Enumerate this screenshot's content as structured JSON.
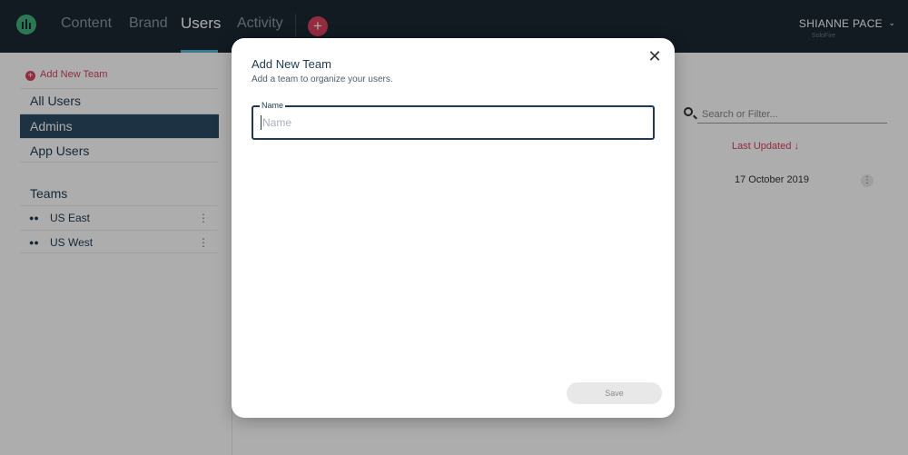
{
  "nav": {
    "items": [
      {
        "label": "Content"
      },
      {
        "label": "Brand"
      },
      {
        "label": "Users"
      },
      {
        "label": "Activity"
      }
    ],
    "active": "Users",
    "add_symbol": "+",
    "user_name": "SHIANNE PACE",
    "user_org": "SoloFire",
    "caret": "⌄"
  },
  "sidebar": {
    "add_team_label": "Add New Team",
    "add_team_symbol": "+",
    "items": [
      {
        "label": "All Users"
      },
      {
        "label": "Admins"
      },
      {
        "label": "App Users"
      }
    ],
    "selected": "Admins",
    "teams_title": "Teams",
    "teams": [
      {
        "label": "US East",
        "menu": "⋮"
      },
      {
        "label": "US West",
        "menu": "⋮"
      }
    ]
  },
  "main": {
    "search": {
      "placeholder": "Search or Filter..."
    },
    "column_header": "Last Updated ↓",
    "rows": [
      {
        "date": "17 October 2019",
        "menu": "⋮"
      }
    ]
  },
  "modal": {
    "title": "Add New Team",
    "subtitle": "Add a team to organize your users.",
    "close_symbol": "✕",
    "field_label": "Name",
    "field_placeholder": "Name",
    "field_value": "",
    "save_label": "Save"
  },
  "colors": {
    "nav_bg": "#1b2733",
    "accent": "#d9425f",
    "selected_bg": "#2c4a63",
    "primary_text": "#1f3a52",
    "logo": "#3fb37a"
  }
}
